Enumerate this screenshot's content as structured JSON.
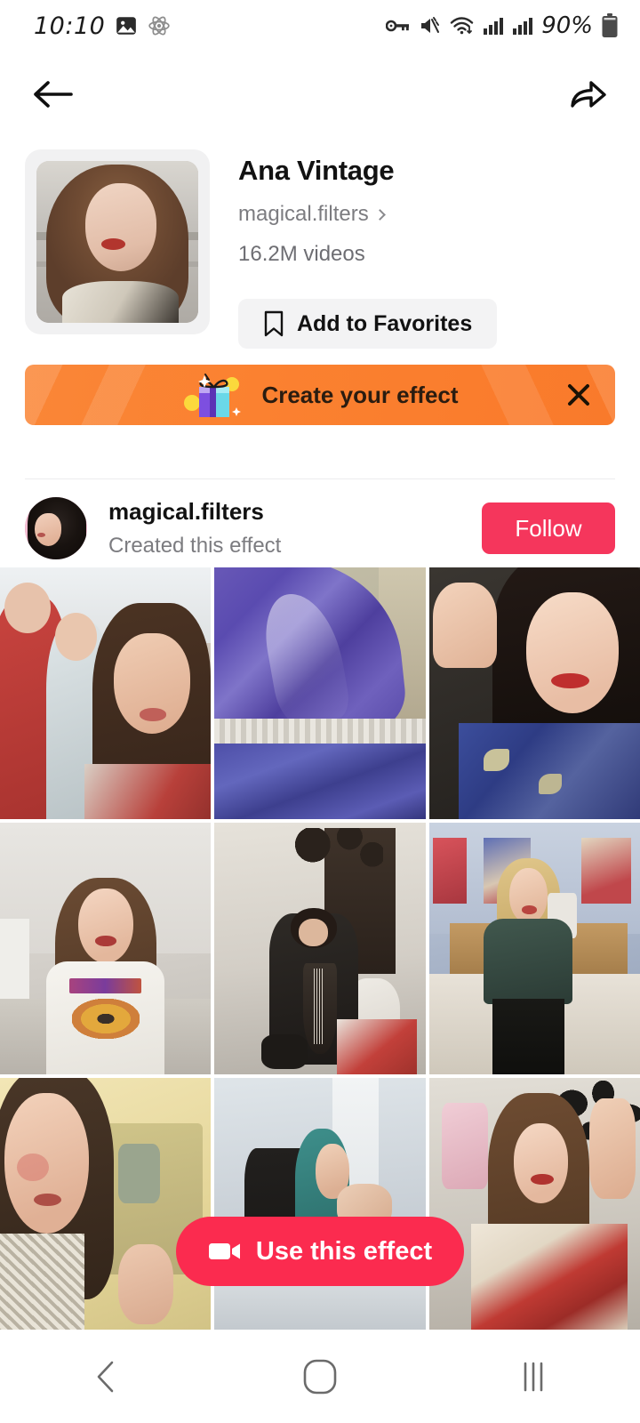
{
  "status_bar": {
    "time": "10:10",
    "battery_percent": "90%",
    "icons": [
      "image-icon",
      "atom-icon",
      "vpn-key-icon",
      "mute-vibrate-icon",
      "wifi-icon",
      "signal-bars-icon",
      "signal-bars-2-icon",
      "battery-icon"
    ]
  },
  "top_nav": {
    "back_icon": "back-arrow-icon",
    "share_icon": "share-arrow-icon"
  },
  "effect": {
    "title": "Ana Vintage",
    "author": "magical.filters",
    "video_count": "16.2M videos",
    "favorite_label": "Add to Favorites",
    "favorite_icon": "bookmark-icon",
    "thumbnail_alt": "effect-preview-thumbnail"
  },
  "promo_banner": {
    "text": "Create your effect",
    "gift_icon": "gift-box-icon",
    "close_icon": "close-x-icon",
    "background_color": "#fa8133"
  },
  "creator": {
    "username": "magical.filters",
    "subtitle": "Created this effect",
    "follow_label": "Follow",
    "follow_color": "#f5365c",
    "avatar_alt": "creator-avatar"
  },
  "grid": {
    "items": [
      {
        "alt": "video-thumbnail-1"
      },
      {
        "alt": "video-thumbnail-2"
      },
      {
        "alt": "video-thumbnail-3"
      },
      {
        "alt": "video-thumbnail-4"
      },
      {
        "alt": "video-thumbnail-5"
      },
      {
        "alt": "video-thumbnail-6"
      },
      {
        "alt": "video-thumbnail-7"
      },
      {
        "alt": "video-thumbnail-8"
      },
      {
        "alt": "video-thumbnail-9"
      }
    ]
  },
  "use_effect": {
    "label": "Use this effect",
    "icon": "video-camera-icon",
    "color": "#fb2b4f"
  },
  "system_nav": {
    "back_icon": "nav-back-icon",
    "home_icon": "nav-home-icon",
    "recents_icon": "nav-recents-icon"
  }
}
